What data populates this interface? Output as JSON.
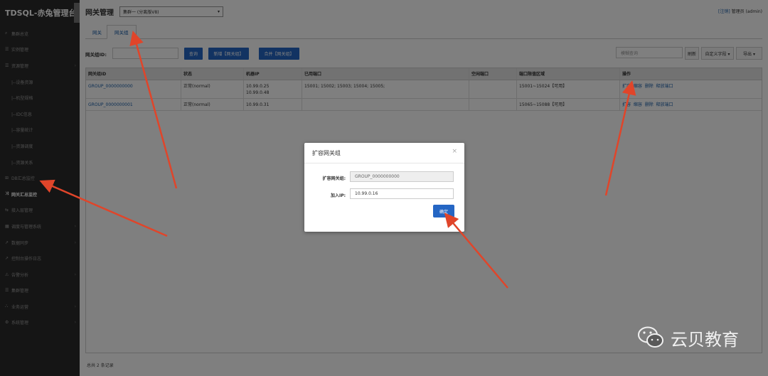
{
  "sidebar": {
    "brand": "TDSQL-赤兔管理台",
    "items": [
      {
        "icon": "search-icon",
        "glyph": "⌕",
        "label": "集群总览",
        "sub": false,
        "expand": false
      },
      {
        "icon": "list-icon",
        "glyph": "☰",
        "label": "实例管理",
        "sub": false,
        "expand": false
      },
      {
        "icon": "resource-icon",
        "glyph": "☰",
        "label": "资源管理",
        "sub": false,
        "expand": true
      },
      {
        "label": "|--设备资源",
        "sub": true
      },
      {
        "label": "|--机型规格",
        "sub": true
      },
      {
        "label": "|--IDC信息",
        "sub": true
      },
      {
        "label": "|--容量统计",
        "sub": true
      },
      {
        "label": "|--资源调度",
        "sub": true
      },
      {
        "label": "|--资源关系",
        "sub": true
      },
      {
        "icon": "db-icon",
        "glyph": "⊞",
        "label": "DB汇总监控",
        "sub": false,
        "expand": false
      },
      {
        "icon": "shuffle-icon",
        "glyph": "⤨",
        "label": "网关汇总监控",
        "sub": false,
        "expand": false,
        "active": true
      },
      {
        "icon": "access-icon",
        "glyph": "⇆",
        "label": "接入层管理",
        "sub": false,
        "expand": false
      },
      {
        "icon": "grid-icon",
        "glyph": "▦",
        "label": "调度与管理系统",
        "sub": false,
        "expand": true
      },
      {
        "icon": "sync-icon",
        "glyph": "↗",
        "label": "数据同步",
        "sub": false,
        "expand": true
      },
      {
        "icon": "log-icon",
        "glyph": "↗",
        "label": "控制台操作日志",
        "sub": false,
        "expand": false
      },
      {
        "icon": "warning-icon",
        "glyph": "⚠",
        "label": "告警分析",
        "sub": false,
        "expand": true
      },
      {
        "icon": "list-icon",
        "glyph": "☰",
        "label": "集群管理",
        "sub": false,
        "expand": false
      },
      {
        "icon": "business-icon",
        "glyph": "⛬",
        "label": "业务运营",
        "sub": false,
        "expand": true
      },
      {
        "icon": "gear-icon",
        "glyph": "⚙",
        "label": "系统管理",
        "sub": false,
        "expand": true
      }
    ]
  },
  "header": {
    "title": "网关管理",
    "cluster": "集群一 (分离版V8)",
    "logout": "[注销]",
    "user": "管理员 (admin)"
  },
  "tabs": [
    "网关",
    "网关组"
  ],
  "toolbar": {
    "id_label": "网关组ID:",
    "query": "查询",
    "add": "新增【网关组】",
    "merge": "合并【网关组】",
    "fuzzy_placeholder": "模糊查询",
    "refresh": "刷新",
    "custom_cols": "自定义字段 ▾",
    "export": "导出 ▾"
  },
  "table": {
    "columns": [
      "网关组ID",
      "状态",
      "机器IP",
      "已用端口",
      "空闲端口",
      "端口限值区域",
      "操作"
    ],
    "rows": [
      {
        "id": "GROUP_0000000000",
        "status": "正常(normal)",
        "ip": "10.99.0.25\n10.99.0.48",
        "used": "15001; 15002; 15003; 15004; 15005;",
        "free": "",
        "range": "15001~15024【可用】",
        "actions": [
          "扩容",
          "缩容",
          "删除",
          "释放端口"
        ]
      },
      {
        "id": "GROUP_0000000001",
        "status": "正常(normal)",
        "ip": "10.99.0.31",
        "used": "",
        "free": "",
        "range": "15065~15088【可用】",
        "actions": [
          "扩容",
          "缩容",
          "删除",
          "释放端口"
        ]
      }
    ],
    "footer": "总共 2 条记录"
  },
  "modal": {
    "title": "扩容网关组",
    "group_label": "扩容网关组:",
    "group_value": "GROUP_0000000000",
    "ip_label": "加入IP:",
    "ip_value": "10.99.0.16",
    "confirm": "确定"
  },
  "watermark": "云贝教育",
  "colors": {
    "accent": "#2566c4",
    "arrow": "#e0452a",
    "sidebar": "#2b2b2b"
  }
}
